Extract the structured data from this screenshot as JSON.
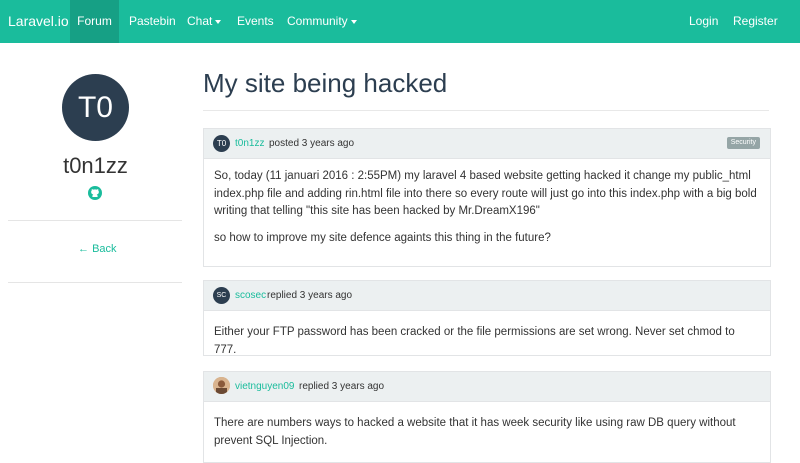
{
  "navbar": {
    "brand": "Laravel.io",
    "items": [
      {
        "label": "Forum"
      },
      {
        "label": "Pastebin"
      },
      {
        "label": "Chat"
      },
      {
        "label": "Events"
      },
      {
        "label": "Community"
      }
    ],
    "login": "Login",
    "register": "Register"
  },
  "sidebar": {
    "avatar_initials": "T0",
    "username": "t0n1zz",
    "back_label": "Back"
  },
  "thread": {
    "title": "My site being hacked",
    "posts": [
      {
        "avatar_initials": "T0",
        "author": "t0n1zz",
        "action": "posted 3 years ago",
        "badge": "Security",
        "paragraphs": [
          "So, today (11 januari 2016 : 2:55PM) my laravel 4 based website getting hacked it change my public_html index.php file and adding rin.html file into there so every route will just go into this index.php with a big bold writing that telling \"this site has been hacked by Mr.DreamX196\"",
          "so how to improve my site defence againts this thing in the future?"
        ]
      },
      {
        "avatar_initials": "SC",
        "author": "scosec",
        "action": "replied 3 years ago",
        "paragraphs": [
          "Either your FTP password has been cracked or the file permissions are set wrong. Never set chmod to 777."
        ]
      },
      {
        "author": "vietnguyen09",
        "action": "replied 3 years ago",
        "paragraphs": [
          "There are numbers ways to hacked a website that it has week security like using raw DB query without prevent SQL Injection."
        ]
      }
    ]
  },
  "colors": {
    "brand": "#1abc9c",
    "brand_dark": "#16a085",
    "title": "#2c3e50",
    "card_header": "#ecf0f1"
  }
}
